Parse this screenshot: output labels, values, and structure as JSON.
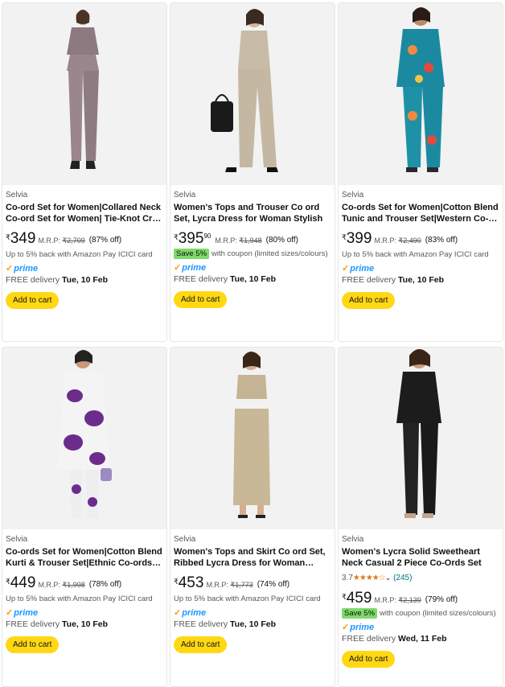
{
  "products": [
    {
      "brand": "Selvia",
      "title": "Co-ord Set for Women|Collared Neck Co-ord Set for Women| Tie-Knot Crop Top and High-Waist Trousers",
      "rating": null,
      "currency": "₹",
      "price_whole": "349",
      "price_fraction": "",
      "mrp_label": "M.R.P:",
      "mrp": "₹2,709",
      "discount": "(87% off)",
      "cashback": "Up to 5% back with Amazon Pay ICICI card",
      "coupon": null,
      "prime": "prime",
      "delivery_prefix": "FREE delivery",
      "delivery_date": "Tue, 10 Feb",
      "cart_label": "Add to cart"
    },
    {
      "brand": "Selvia",
      "title": "Women's Tops and Trouser Co ord Set, Lycra Dress for Woman Stylish",
      "rating": null,
      "currency": "₹",
      "price_whole": "395",
      "price_fraction": "90",
      "mrp_label": "M.R.P:",
      "mrp": "₹1,948",
      "discount": "(80% off)",
      "cashback": null,
      "coupon": {
        "badge": "Save 5%",
        "text": "with coupon (limited sizes/colours)"
      },
      "prime": "prime",
      "delivery_prefix": "FREE delivery",
      "delivery_date": "Tue, 10 Feb",
      "cart_label": "Add to cart"
    },
    {
      "brand": "Selvia",
      "title": "Co-ords Set for Women|Cotton Blend Tunic and Trouser Set|Western Co-ord Set",
      "rating": null,
      "currency": "₹",
      "price_whole": "399",
      "price_fraction": "",
      "mrp_label": "M.R.P:",
      "mrp": "₹2,490",
      "discount": "(83% off)",
      "cashback": "Up to 5% back with Amazon Pay ICICI card",
      "coupon": null,
      "prime": "prime",
      "delivery_prefix": "FREE delivery",
      "delivery_date": "Tue, 10 Feb",
      "cart_label": "Add to cart"
    },
    {
      "brand": "Selvia",
      "title": "Co-ords Set for Women|Cotton Blend Kurti & Trouser Set|Ethnic Co-ords Set",
      "rating": null,
      "currency": "₹",
      "price_whole": "449",
      "price_fraction": "",
      "mrp_label": "M.R.P:",
      "mrp": "₹1,998",
      "discount": "(78% off)",
      "cashback": "Up to 5% back with Amazon Pay ICICI card",
      "coupon": null,
      "prime": "prime",
      "delivery_prefix": "FREE delivery",
      "delivery_date": "Tue, 10 Feb",
      "cart_label": "Add to cart"
    },
    {
      "brand": "Selvia",
      "title": "Women's Tops and Skirt Co ord Set, Ribbed Lycra Dress for Woman Stylish",
      "rating": null,
      "currency": "₹",
      "price_whole": "453",
      "price_fraction": "",
      "mrp_label": "M.R.P:",
      "mrp": "₹1,773",
      "discount": "(74% off)",
      "cashback": "Up to 5% back with Amazon Pay ICICI card",
      "coupon": null,
      "prime": "prime",
      "delivery_prefix": "FREE delivery",
      "delivery_date": "Tue, 10 Feb",
      "cart_label": "Add to cart"
    },
    {
      "brand": "Selvia",
      "title": "Women's Lycra Solid Sweetheart Neck Casual 2 Piece Co-Ords Set",
      "rating": {
        "value": "3.7",
        "stars": "★★★★☆",
        "count": "(245)"
      },
      "currency": "₹",
      "price_whole": "459",
      "price_fraction": "",
      "mrp_label": "M.R.P:",
      "mrp": "₹2,139",
      "discount": "(79% off)",
      "cashback": null,
      "coupon": {
        "badge": "Save 5%",
        "text": "with coupon (limited sizes/colours)"
      },
      "prime": "prime",
      "delivery_prefix": "FREE delivery",
      "delivery_date": "Wed, 11 Feb",
      "cart_label": "Add to cart"
    }
  ],
  "icons": {
    "prime_check": "check-icon",
    "rating_dropdown": "chevron-down-icon"
  },
  "colors": {
    "cart_button": "#ffd814",
    "prime": "#1a98ff",
    "save_badge": "#7fda69",
    "stars": "#de7921",
    "link": "#007185"
  }
}
